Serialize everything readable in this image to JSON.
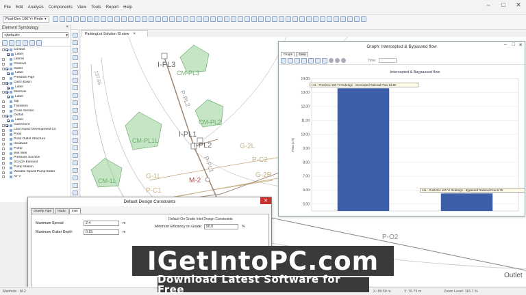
{
  "menu": [
    "File",
    "Edit",
    "Analysis",
    "Components",
    "View",
    "Tools",
    "Report",
    "Help"
  ],
  "window_controls": {
    "minimize": "–",
    "maximize": "□",
    "close": "✕"
  },
  "toolbar": {
    "scenario": "Post-Dev 100 Yr Rede"
  },
  "symbology": {
    "title": "Element Symbology",
    "dropdown": "<default>",
    "items": [
      {
        "label": "Conduit",
        "child": false,
        "checked": true
      },
      {
        "label": "Label",
        "child": true,
        "checked": true
      },
      {
        "label": "Lateral",
        "child": false,
        "checked": false
      },
      {
        "label": "Channel",
        "child": false,
        "checked": false
      },
      {
        "label": "Gutter",
        "child": false,
        "checked": true
      },
      {
        "label": "Label",
        "child": true,
        "checked": true
      },
      {
        "label": "Pressure Pipe",
        "child": false,
        "checked": false
      },
      {
        "label": "Catch Basin",
        "child": false,
        "checked": true
      },
      {
        "label": "Label",
        "child": true,
        "checked": true
      },
      {
        "label": "Manhole",
        "child": false,
        "checked": true
      },
      {
        "label": "Label",
        "child": true,
        "checked": true
      },
      {
        "label": "Tap",
        "child": false,
        "checked": false
      },
      {
        "label": "Transition",
        "child": false,
        "checked": false
      },
      {
        "label": "Cross Section",
        "child": false,
        "checked": false
      },
      {
        "label": "Outfall",
        "child": false,
        "checked": true
      },
      {
        "label": "Label",
        "child": true,
        "checked": true
      },
      {
        "label": "Catchment",
        "child": false,
        "checked": true
      },
      {
        "label": "Low Impact Development Co",
        "child": false,
        "checked": false
      },
      {
        "label": "Pond",
        "child": false,
        "checked": false
      },
      {
        "label": "Pond Outlet Structure",
        "child": false,
        "checked": false
      },
      {
        "label": "Headwall",
        "child": false,
        "checked": false
      },
      {
        "label": "Pump",
        "child": false,
        "checked": false
      },
      {
        "label": "Wet Well",
        "child": false,
        "checked": false
      },
      {
        "label": "Pressure Junction",
        "child": false,
        "checked": false
      },
      {
        "label": "SCADA Element",
        "child": false,
        "checked": false
      },
      {
        "label": "Pump Station",
        "child": false,
        "checked": false
      },
      {
        "label": "Variable Speed Pump Batter",
        "child": false,
        "checked": false
      },
      {
        "label": "Air V",
        "child": false,
        "checked": false
      }
    ]
  },
  "document_tab": {
    "label": "ParkingLot Solution SI.stsw",
    "close": "×"
  },
  "map_labels": {
    "i_pl3": "I-PL3",
    "cm_pl3": "CM-PL3",
    "p_pl2": "P-PL2",
    "cm_pl2": "CM-PL2",
    "i_pl1": "I-PL1",
    "cm_pl1l": "CM-PL1L",
    "i_pl2": "I-PL2",
    "p_pl1": "P-PL1",
    "cm_1l": "CM-1L",
    "g_1l": "G-1L",
    "g_2l": "G-2L",
    "m_2": "M-2",
    "p_c1": "P-C1",
    "p_c2": "P-C2",
    "g_2r": "G-2R",
    "p_o2": "P-O2",
    "outlet": "Outlet",
    "elev": "137.65"
  },
  "graph": {
    "title": "Graph: Intercepted & Bypassed flow",
    "tabs": [
      "Graph",
      "Data"
    ],
    "time_label": "Time:"
  },
  "chart_data": {
    "type": "bar",
    "title": "Intercepted & Baypassed flow",
    "ylabel": "Flow (L/s)",
    "ylim": [
      4.5,
      14.0
    ],
    "yticks": [
      "5.00",
      "6.00",
      "7.00",
      "8.00",
      "9.00",
      "10.00",
      "11.00",
      "12.00",
      "13.00",
      "14.00"
    ],
    "series": [
      {
        "label": "I-4L - Post-Dev 100 Yr Redesign - Intercepted Rational Flow 13.30",
        "value": 13.3,
        "color": "#3d5ea9"
      },
      {
        "label": "I-4L - Post-Dev 100 Yr Redesign - Bypassed Rational Flow 5.76",
        "value": 5.76,
        "color": "#3d5ea9"
      }
    ],
    "grid": true
  },
  "dialog": {
    "title": "Default Design Constraints",
    "close": "✕",
    "tabs": [
      "Gravity Pipe",
      "Node",
      "Inlet"
    ],
    "group_title": "Default On Grade Inlet Design Constraints",
    "fields": [
      {
        "label": "Maximum Spread",
        "value": "2.4",
        "unit": "m"
      },
      {
        "label": "Maximum Gutter Depth",
        "value": "0.15",
        "unit": "m"
      },
      {
        "label": "Minimum Efficiency on Grade:",
        "value": "50.0",
        "unit": "%"
      }
    ]
  },
  "status": {
    "left": "Manhole : M-2",
    "x": "X: 89.50 m",
    "y": "Y: 76.75 m",
    "zoom": "Zoom Level: 116.7 %"
  },
  "watermark": {
    "top": "IGetIntoPC.com",
    "bottom": "Download Latest Software for Free"
  }
}
